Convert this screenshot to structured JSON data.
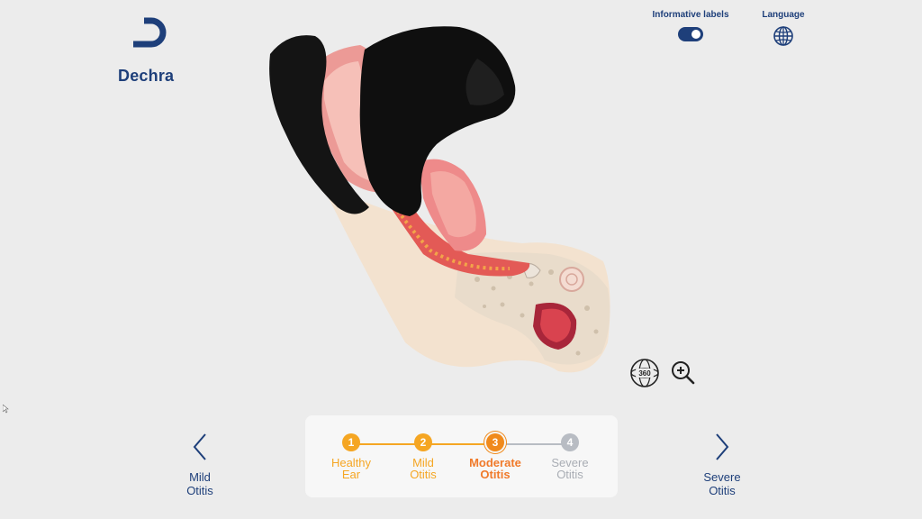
{
  "brand": {
    "name": "Dechra"
  },
  "header": {
    "labels_toggle": {
      "label": "Informative labels",
      "on": true
    },
    "language": {
      "label": "Language",
      "icon": "globe-icon"
    }
  },
  "view_tools": [
    {
      "name": "rotate-360",
      "icon": "360-globe-icon",
      "text": "360"
    },
    {
      "name": "zoom-in",
      "icon": "zoom-in-icon"
    }
  ],
  "nav": {
    "prev": {
      "label": "Mild\nOtitis",
      "icon": "chevron-left-icon"
    },
    "next": {
      "label": "Severe\nOtitis",
      "icon": "chevron-right-icon"
    }
  },
  "stepper": {
    "current": 3,
    "steps": [
      {
        "number": "1",
        "label": "Healthy\nEar",
        "state": "done"
      },
      {
        "number": "2",
        "label": "Mild\nOtitis",
        "state": "done"
      },
      {
        "number": "3",
        "label": "Moderate\nOtitis",
        "state": "active"
      },
      {
        "number": "4",
        "label": "Severe\nOtitis",
        "state": "upcoming"
      }
    ]
  },
  "colors": {
    "brand_navy": "#1e3f7a",
    "step_done": "#f5a623",
    "step_active": "#f08a1c",
    "step_upcoming": "#b8bcc3",
    "step_done_text": "#f5a623",
    "step_active_text": "#f07a2a",
    "step_upcoming_text": "#a9adb4"
  }
}
